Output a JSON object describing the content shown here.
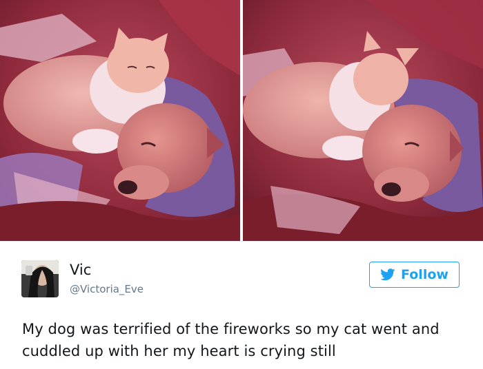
{
  "media": {
    "photos": [
      {
        "description_icon": "cat-dog-photo"
      },
      {
        "description_icon": "cat-dog-photo"
      }
    ]
  },
  "author": {
    "display_name": "Vic",
    "handle": "@Victoria_Eve"
  },
  "follow_button": {
    "label": "Follow",
    "icon": "twitter-bird-icon",
    "color": "#1da1f2"
  },
  "tweet": {
    "text": "My dog was terrified of the fireworks so my cat went and cuddled up with her my heart is crying still"
  },
  "colors": {
    "name": "#14171a",
    "handle": "#657786",
    "accent": "#1da1f2"
  }
}
